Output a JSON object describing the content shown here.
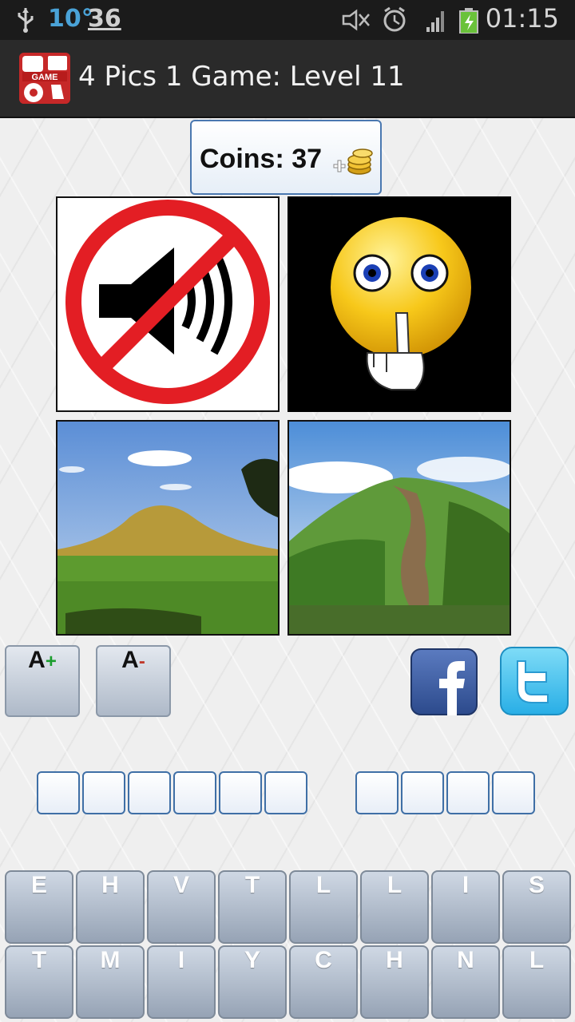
{
  "status_bar": {
    "temperature": "10°",
    "notification_count": "36",
    "time": "01:15",
    "icons": [
      "usb-icon",
      "mute-icon",
      "alarm-icon",
      "signal-icon",
      "battery-charging-icon"
    ]
  },
  "title_bar": {
    "app_icon": "game-controller-icon",
    "app_icon_text": "GAME",
    "title": "4 Pics 1 Game: Level 11"
  },
  "coins": {
    "label": "Coins: 37",
    "icon": "coins-plus-icon"
  },
  "pictures": [
    {
      "name": "no-sound-sign"
    },
    {
      "name": "shush-smiley"
    },
    {
      "name": "grassy-mound"
    },
    {
      "name": "hill-path"
    }
  ],
  "font_controls": {
    "increase_label": "A",
    "increase_sign": "+",
    "decrease_label": "A",
    "decrease_sign": "-"
  },
  "share": {
    "facebook_icon": "facebook-icon",
    "twitter_icon": "twitter-icon"
  },
  "answer": {
    "word_lengths": [
      6,
      4
    ]
  },
  "keyboard": {
    "row1": [
      "E",
      "H",
      "V",
      "T",
      "L",
      "L",
      "I",
      "S"
    ],
    "row2": [
      "T",
      "M",
      "I",
      "Y",
      "C",
      "H",
      "N",
      "L"
    ]
  },
  "colors": {
    "accent_blue": "#3f6fa6",
    "plus_green": "#1a9d2d",
    "minus_red": "#c0392b",
    "key_gray": "#a9b4c4"
  }
}
